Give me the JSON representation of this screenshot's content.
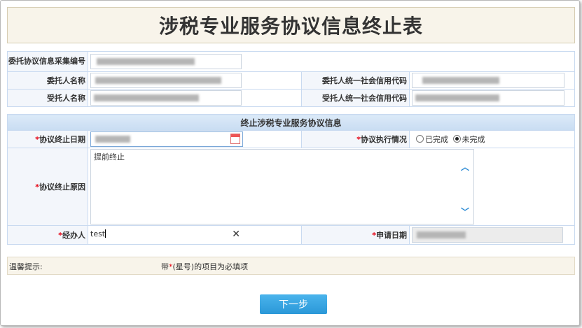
{
  "title": "涉税专业服务协议信息终止表",
  "info": {
    "contract_no_label": "委托协议信息采集编号",
    "client_name_label": "委托人名称",
    "client_credit_label": "委托人统一社会信用代码",
    "agent_name_label": "受托人名称",
    "agent_credit_label": "受托人统一社会信用代码"
  },
  "section": {
    "header": "终止涉税专业服务协议信息",
    "end_date_label": "协议终止日期",
    "status_label": "协议执行情况",
    "status_options": [
      "已完成",
      "未完成"
    ],
    "status_selected": "未完成",
    "reason_label": "协议终止原因",
    "reason_value": "提前终止",
    "handler_label": "经办人",
    "handler_value": "test",
    "apply_date_label": "申请日期",
    "required_mark": "*"
  },
  "tip": {
    "label": "温馨提示:",
    "text_before": "带",
    "star": "*",
    "text_after": "(星号)的项目为必填项"
  },
  "next_button": "下一步",
  "icons": {
    "calendar": "calendar-icon",
    "clear": "clear-icon",
    "scroll_up": "chevron-up-icon",
    "scroll_down": "chevron-down-icon"
  },
  "colors": {
    "required": "#e60012",
    "button": "#2a98d8",
    "section_header": "#c8dcf2"
  }
}
